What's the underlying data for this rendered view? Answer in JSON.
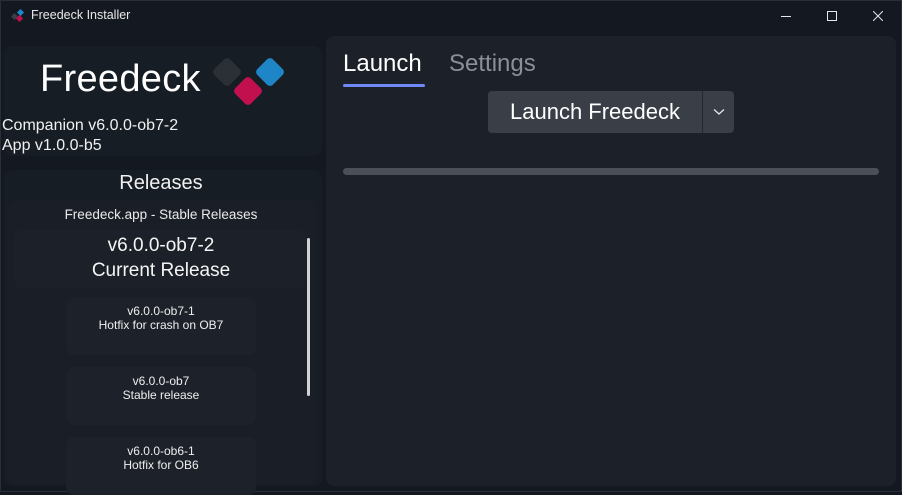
{
  "window": {
    "title": "Freedeck Installer",
    "controls": {
      "minimize": "minimize-icon",
      "maximize": "maximize-icon",
      "close": "close-icon"
    }
  },
  "header": {
    "brand": "Freedeck",
    "companion_version": "Companion v6.0.0-ob7-2",
    "app_version": "App v1.0.0-b5",
    "logo_colors": {
      "dark": "#2b2f36",
      "blue": "#1e86c6",
      "pink": "#c2104f"
    }
  },
  "releases": {
    "heading": "Releases",
    "source_title": "Freedeck.app - Stable Releases",
    "current": {
      "version": "v6.0.0-ob7-2",
      "label": "Current Release"
    },
    "items": [
      {
        "version": "v6.0.0-ob7-1",
        "description": "Hotfix for crash on OB7"
      },
      {
        "version": "v6.0.0-ob7",
        "description": "Stable release"
      },
      {
        "version": "v6.0.0-ob6-1",
        "description": "Hotfix for OB6"
      }
    ]
  },
  "tabs": [
    {
      "label": "Launch",
      "active": true
    },
    {
      "label": "Settings",
      "active": false
    }
  ],
  "launch": {
    "button_label": "Launch Freedeck",
    "dropdown_icon": "chevron-down-icon",
    "progress": 0
  },
  "colors": {
    "accent": "#6e88f5",
    "panel": "#1b2029",
    "background": "#141921"
  }
}
